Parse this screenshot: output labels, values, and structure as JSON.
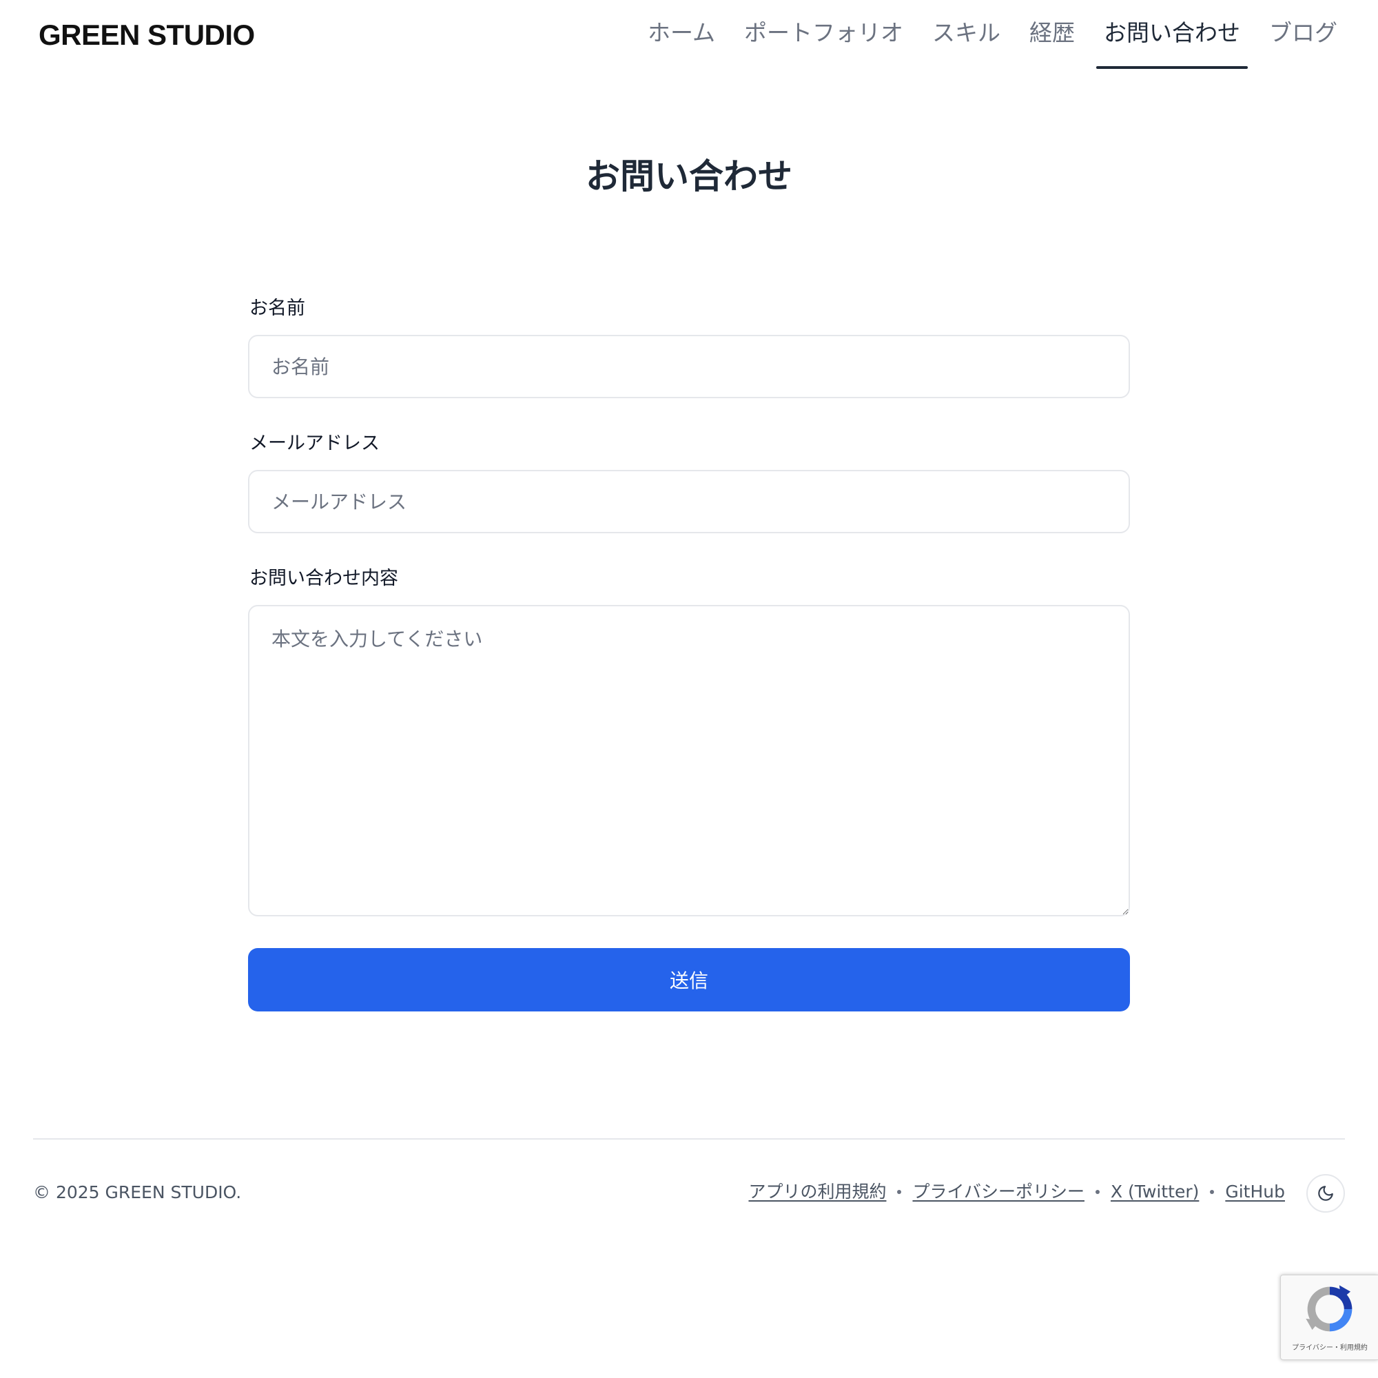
{
  "brand": "GREEN STUDIO",
  "nav": {
    "items": [
      {
        "label": "ホーム"
      },
      {
        "label": "ポートフォリオ"
      },
      {
        "label": "スキル"
      },
      {
        "label": "経歴"
      },
      {
        "label": "お問い合わせ",
        "active": true
      },
      {
        "label": "ブログ"
      }
    ]
  },
  "page": {
    "title": "お問い合わせ"
  },
  "form": {
    "name": {
      "label": "お名前",
      "placeholder": "お名前",
      "value": ""
    },
    "email": {
      "label": "メールアドレス",
      "placeholder": "メールアドレス",
      "value": ""
    },
    "message": {
      "label": "お問い合わせ内容",
      "placeholder": "本文を入力してください",
      "value": ""
    },
    "submit_label": "送信"
  },
  "footer": {
    "copyright": "© 2025 GREEN STUDIO.",
    "links": [
      {
        "label": "アプリの利用規約"
      },
      {
        "label": "プライバシーポリシー"
      },
      {
        "label": "X (Twitter)"
      },
      {
        "label": "GitHub"
      }
    ],
    "theme_toggle_icon": "moon-icon"
  },
  "recaptcha": {
    "terms": "プライバシー・利用規約",
    "icon": "recaptcha-icon"
  },
  "colors": {
    "accent": "#2563eb",
    "text": "#1f2937",
    "muted": "#6b7280",
    "border": "#e5e7eb"
  }
}
